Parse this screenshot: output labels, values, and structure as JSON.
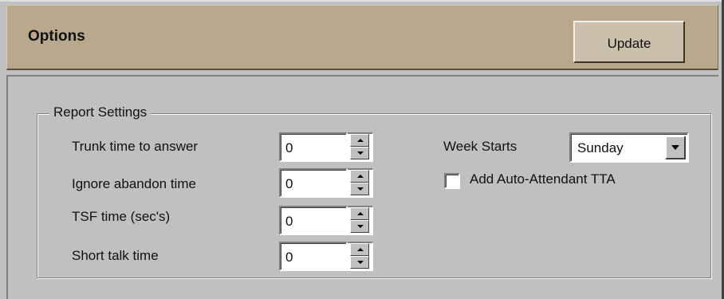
{
  "header": {
    "title": "Options",
    "update_label": "Update"
  },
  "report_settings": {
    "group_label": "Report Settings",
    "fields": [
      {
        "label": "Trunk time to answer",
        "value": "0"
      },
      {
        "label": "Ignore abandon time",
        "value": "0"
      },
      {
        "label": "TSF time (sec's)",
        "value": "0"
      },
      {
        "label": "Short talk time",
        "value": "0"
      }
    ],
    "week_starts": {
      "label": "Week Starts",
      "selected": "Sunday"
    },
    "auto_attendant": {
      "label": "Add Auto-Attendant TTA",
      "checked": false
    }
  }
}
